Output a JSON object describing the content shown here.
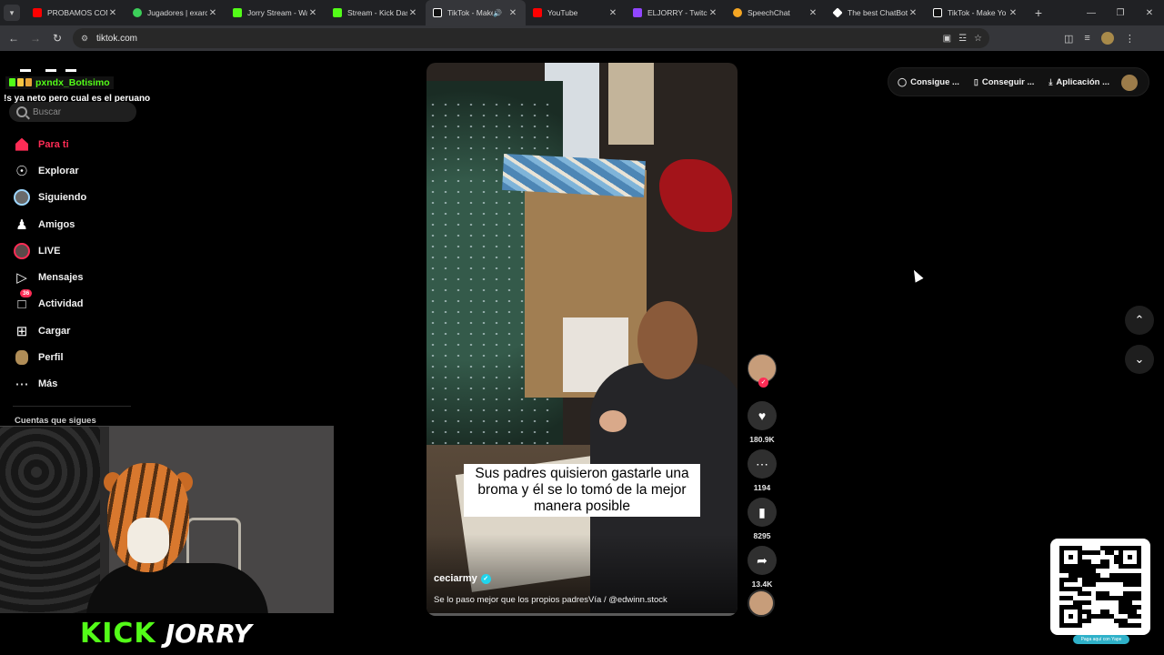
{
  "browser": {
    "tabs": [
      {
        "title": "PROBAMOS COM",
        "favicon_color": "#ff0000",
        "active": false
      },
      {
        "title": "Jugadores | exarc",
        "favicon_color": "#3ccf5a",
        "active": false
      },
      {
        "title": "Jorry Stream - Wa",
        "favicon_color": "#53fc18",
        "active": false
      },
      {
        "title": "Stream - Kick Das",
        "favicon_color": "#53fc18",
        "active": false
      },
      {
        "title": "TikTok - Make",
        "favicon_color": "#ffffff",
        "active": true
      },
      {
        "title": "YouTube",
        "favicon_color": "#ff0000",
        "active": false
      },
      {
        "title": "ELJORRY - Twitch",
        "favicon_color": "#9146ff",
        "active": false
      },
      {
        "title": "SpeechChat",
        "favicon_color": "#f5a623",
        "active": false
      },
      {
        "title": "The best ChatBot",
        "favicon_color": "#ffffff",
        "active": false
      },
      {
        "title": "TikTok - Make Yo",
        "favicon_color": "#ffffff",
        "active": false
      }
    ],
    "url": "tiktok.com"
  },
  "chat_overlay": {
    "username": "pxndx_Botisimo",
    "message": "!s ya neto pero cual es el peruano"
  },
  "search": {
    "placeholder": "Buscar"
  },
  "sidebar": {
    "items": [
      {
        "label": "Para ti"
      },
      {
        "label": "Explorar"
      },
      {
        "label": "Siguiendo"
      },
      {
        "label": "Amigos"
      },
      {
        "label": "LIVE"
      },
      {
        "label": "Mensajes"
      },
      {
        "label": "Actividad",
        "badge": "36"
      },
      {
        "label": "Cargar"
      },
      {
        "label": "Perfil"
      },
      {
        "label": "Más"
      }
    ],
    "following_title": "Cuentas que sigues"
  },
  "stream_branding": {
    "kick": "KICK",
    "streamer": "JORRY"
  },
  "video": {
    "caption": "Sus padres quisieron gastarle una broma y él se lo tomó de la mejor manera posible",
    "author": "ceciarmy",
    "description": "Se lo paso mejor que los propios padresVía / @edwinn.stock"
  },
  "actions": {
    "likes": "180.9K",
    "comments": "1194",
    "saves": "8295",
    "shares": "13.4K"
  },
  "header_buttons": {
    "coins": "Consigue ...",
    "app": "Conseguir ...",
    "desktop": "Aplicación ..."
  },
  "qr": {
    "caption": "Paga aquí con Yape"
  },
  "colors": {
    "accent": "#fe2c55",
    "kick_green": "#53fc18",
    "verified": "#20d5ec"
  }
}
